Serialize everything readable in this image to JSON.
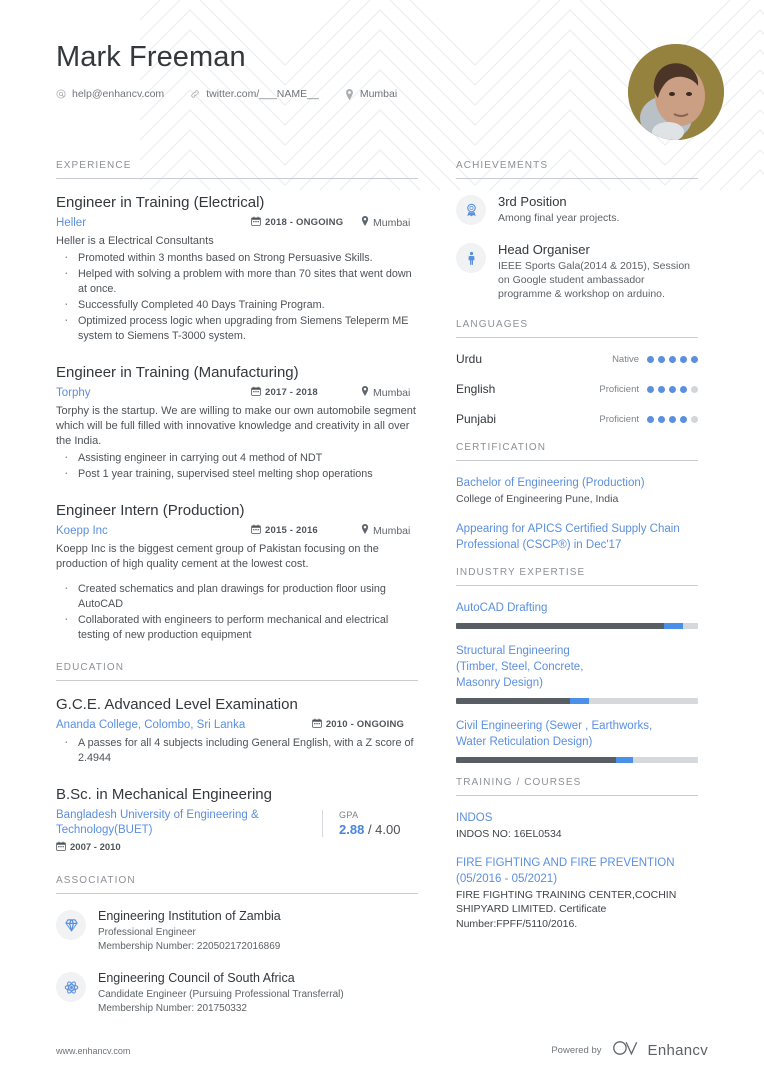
{
  "header": {
    "name": "Mark Freeman",
    "contacts": [
      {
        "icon": "email-icon",
        "text": "help@enhancv.com"
      },
      {
        "icon": "link-icon",
        "text": "twitter.com/___NAME__"
      },
      {
        "icon": "location-pin-icon",
        "text": "Mumbai"
      }
    ]
  },
  "left": {
    "experience": {
      "title": "EXPERIENCE",
      "entries": [
        {
          "role": "Engineer in Training (Electrical)",
          "company": "Heller",
          "date": "2018 - ONGOING",
          "location": "Mumbai",
          "desc": "Heller is a Electrical Consultants",
          "bullets": [
            "Promoted within 3 months based on Strong Persuasive Skills.",
            "Helped with solving a problem with more than 70 sites that went down at once.",
            "Successfully Completed 40 Days Training Program.",
            "Optimized process logic when upgrading from Siemens Teleperm ME system to Siemens T-3000 system."
          ]
        },
        {
          "role": "Engineer in Training (Manufacturing)",
          "company": "Torphy",
          "date": "2017 - 2018",
          "location": "Mumbai",
          "desc": "Torphy is the startup. We are willing to make our own automobile segment which will be full filled with innovative knowledge and creativity in all over the India.",
          "bullets": [
            "Assisting engineer in carrying out 4 method of NDT",
            "Post 1 year training, supervised steel melting shop operations"
          ]
        },
        {
          "role": "Engineer Intern (Production)",
          "company": "Koepp Inc",
          "date": "2015 - 2016",
          "location": "Mumbai",
          "desc": "Koepp Inc is the biggest cement group of Pakistan focusing on the production of high quality cement at the lowest cost.",
          "bullets": [
            "Created schematics and plan drawings for production floor using AutoCAD",
            "Collaborated with engineers to perform mechanical and electrical testing of new production equipment"
          ]
        }
      ]
    },
    "education": {
      "title": "EDUCATION",
      "entries": [
        {
          "degree": "G.C.E. Advanced Level Examination",
          "school": "Ananda College, Colombo, Sri Lanka",
          "date": "2010 - ONGOING",
          "bullets": [
            "A passes for all 4 subjects including General English, with a Z score of 2.4944"
          ]
        },
        {
          "degree": "B.Sc. in Mechanical Engineering",
          "school": "Bangladesh University of Engineering & Technology(BUET)",
          "date": "2007 - 2010",
          "gpa_label": "GPA",
          "gpa_value": "2.88",
          "gpa_scale": "/ 4.00"
        }
      ]
    },
    "association": {
      "title": "ASSOCIATION",
      "items": [
        {
          "icon": "diamond-icon",
          "title": "Engineering Institution of Zambia",
          "line1": "Professional Engineer",
          "line2": "Membership Number: 220502172016869"
        },
        {
          "icon": "atom-icon",
          "title": "Engineering Council of South Africa",
          "line1": "Candidate Engineer (Pursuing Professional Transferral)",
          "line2": "Membership Number: 201750332"
        }
      ]
    }
  },
  "right": {
    "achievements": {
      "title": "ACHIEVEMENTS",
      "items": [
        {
          "icon": "award-ribbon-icon",
          "title": "3rd Position",
          "desc": "Among final year projects."
        },
        {
          "icon": "person-icon",
          "title": "Head Organiser",
          "desc": "IEEE Sports Gala(2014 & 2015), Session on Google student ambassador programme & workshop on arduino."
        }
      ]
    },
    "languages": {
      "title": "LANGUAGES",
      "items": [
        {
          "name": "Urdu",
          "level": "Native",
          "filled": 5,
          "total": 5
        },
        {
          "name": "English",
          "level": "Proficient",
          "filled": 4,
          "total": 5
        },
        {
          "name": "Punjabi",
          "level": "Proficient",
          "filled": 4,
          "total": 5
        }
      ]
    },
    "certification": {
      "title": "CERTIFICATION",
      "items": [
        {
          "title": "Bachelor of Engineering (Production)",
          "sub": "College of Engineering Pune, India"
        },
        {
          "title": "Appearing  for APICS Certified Supply Chain Professional (CSCP®) in Dec'17",
          "sub": ""
        }
      ]
    },
    "industry_expertise": {
      "title": "INDUSTRY EXPERTISE",
      "items": [
        {
          "name": "AutoCAD Drafting",
          "fill_pct": 86,
          "marker_pct": 8
        },
        {
          "name": "Structural Engineering\n (Timber, Steel, Concrete,\n Masonry Design)",
          "fill_pct": 47,
          "marker_pct": 8
        },
        {
          "name": "Civil Engineering (Sewer , Earthworks,\nWater Reticulation Design)",
          "fill_pct": 66,
          "marker_pct": 7
        }
      ]
    },
    "training": {
      "title": "TRAINING / COURSES",
      "items": [
        {
          "title": "INDOS",
          "sub": "INDOS NO: 16EL0534"
        },
        {
          "title": "FIRE FIGHTING AND FIRE PREVENTION (05/2016 - 05/2021)",
          "sub": "FIRE FIGHTING TRAINING CENTER,COCHIN SHIPYARD LIMITED.  Certificate Number:FPFF/5110/2016."
        }
      ]
    }
  },
  "footer": {
    "url": "www.enhancv.com",
    "powered_by": "Powered by",
    "brand": "Enhancv"
  },
  "colors": {
    "accent_blue": "#5b8fe0",
    "bar_dark": "#585e64",
    "bar_marker": "#4a90e8",
    "bar_track": "#d6d9dc",
    "text_dark": "#33383d",
    "text_muted": "#6f757b"
  }
}
